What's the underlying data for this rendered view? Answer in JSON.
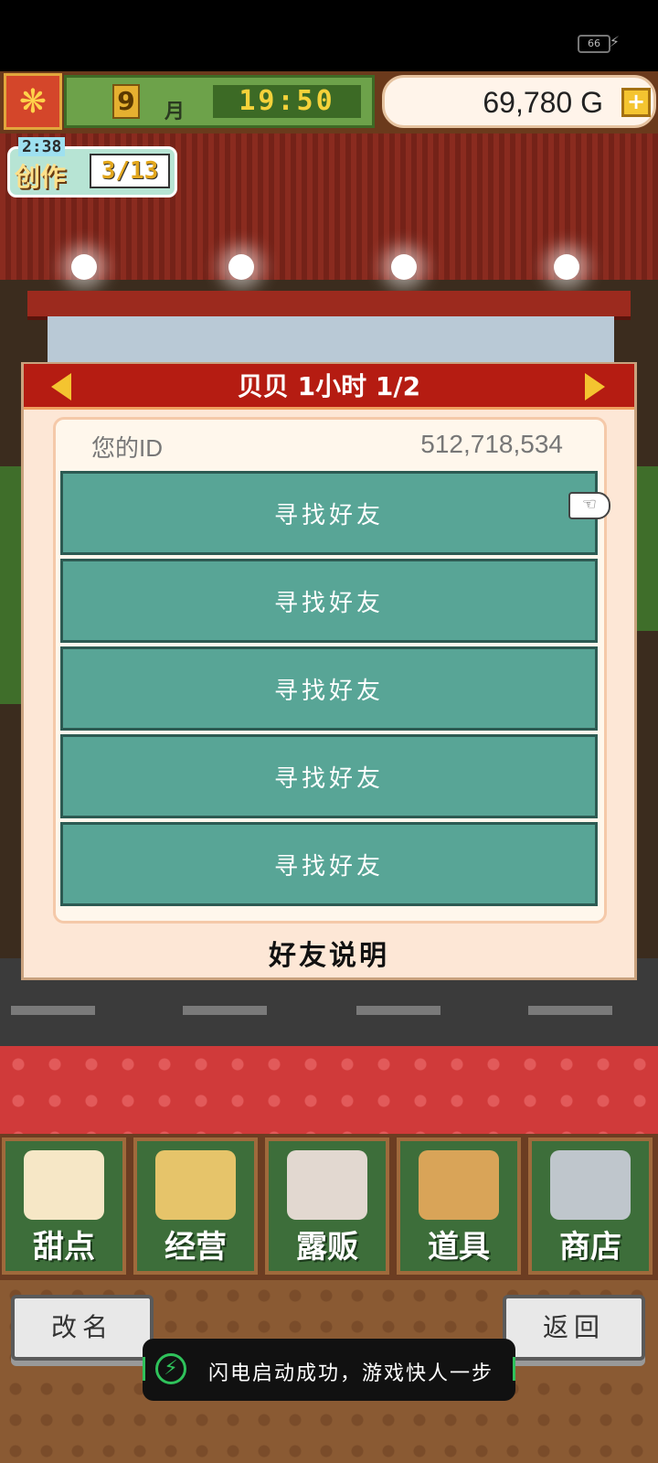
{
  "status_bar": {
    "battery": "66",
    "charging_icon": "lightning-icon"
  },
  "hud": {
    "season_icon": "maple-leaf-icon",
    "month": "9",
    "month_unit": "月",
    "time": "19:50",
    "money": "69,780 G",
    "add_icon": "plus-icon"
  },
  "creation": {
    "timer": "2:38",
    "label": "创作",
    "progress": "3/13"
  },
  "dialog": {
    "title": "贝贝  1小时 1/2",
    "id_label": "您的ID",
    "id_value": "512,718,534",
    "friend_slots": [
      "寻找好友",
      "寻找好友",
      "寻找好友",
      "寻找好友",
      "寻找好友"
    ],
    "explain": "好友说明",
    "cursor_icon": "pointing-hand-icon"
  },
  "nav": [
    {
      "label": "甜点",
      "icon": "cake-icon",
      "color": "#f6e7c6"
    },
    {
      "label": "经营",
      "icon": "shop-building-icon",
      "color": "#e6c46a"
    },
    {
      "label": "露贩",
      "icon": "food-truck-icon",
      "color": "#e2d8d0"
    },
    {
      "label": "道具",
      "icon": "gear-and-sack-icon",
      "color": "#d9a458"
    },
    {
      "label": "商店",
      "icon": "shopping-cart-icon",
      "color": "#bfc6cc"
    }
  ],
  "buttons": {
    "rename": "改名",
    "back": "返回"
  },
  "toast": {
    "icon": "lightning-icon",
    "text": "闪电启动成功，游戏快人一步"
  }
}
